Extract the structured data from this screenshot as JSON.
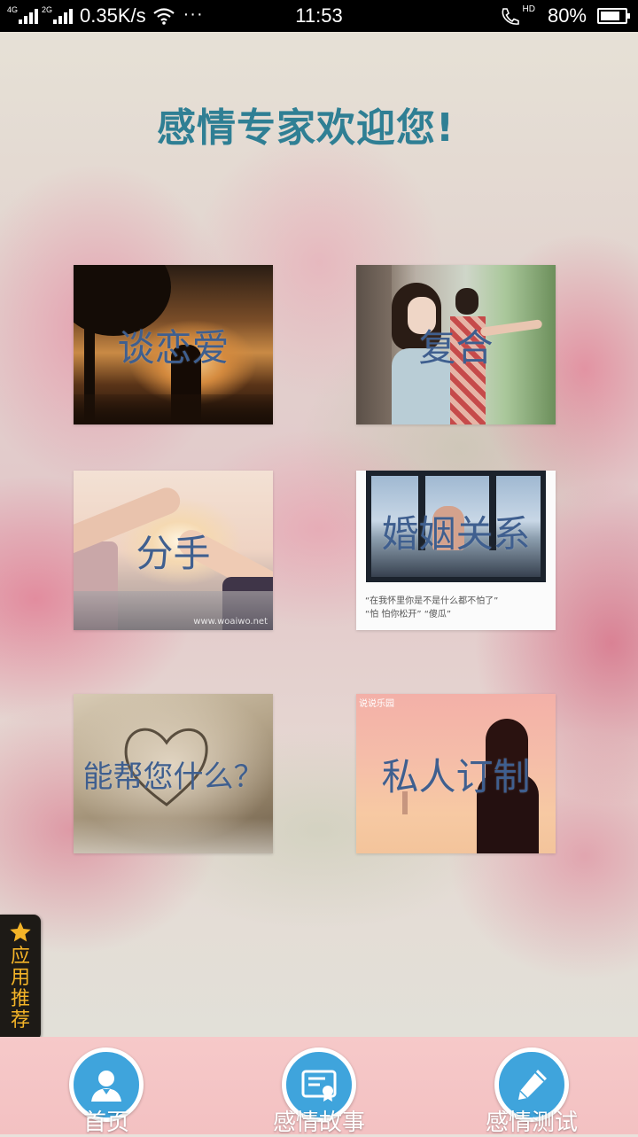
{
  "status_bar": {
    "network_a": "4G",
    "network_b": "2G",
    "speed": "0.35K/s",
    "more": "···",
    "time": "11:53",
    "hd": "HD",
    "battery_percent": "80%",
    "battery_level": 0.8
  },
  "header": {
    "title": "感情专家欢迎您!"
  },
  "tiles": [
    {
      "label": "谈恋爱"
    },
    {
      "label": "复合"
    },
    {
      "label": "分手",
      "watermark": "www.woaiwo.net"
    },
    {
      "label": "婚姻关系",
      "caption_line1": "“在我怀里你是不是什么都不怕了”",
      "caption_line2": "“怕 怕你松开” “傻瓜”"
    },
    {
      "label": "能帮您什么？"
    },
    {
      "label": "私人订制",
      "tag": "说说乐园"
    }
  ],
  "recommend": {
    "label": "应用推荐",
    "icon": "star-icon",
    "color": "#f4b428"
  },
  "bottom_nav": [
    {
      "label": "首页",
      "icon": "user-icon"
    },
    {
      "label": "感情故事",
      "icon": "certificate-icon"
    },
    {
      "label": "感情测试",
      "icon": "pencil-icon"
    }
  ],
  "colors": {
    "accent_blue": "#3fa4dc",
    "title_teal": "#2f7f94",
    "tile_text": "#3f5f8f",
    "nav_pink": "#f6c9c9"
  }
}
